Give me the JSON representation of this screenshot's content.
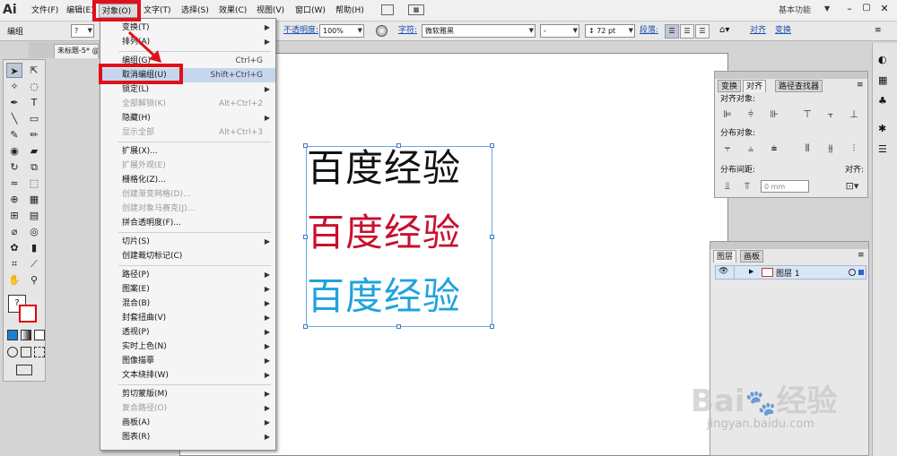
{
  "app": {
    "logo": "Ai"
  },
  "menubar": {
    "items": [
      "文件(F)",
      "编辑(E)",
      "对象(O)",
      "文字(T)",
      "选择(S)",
      "效果(C)",
      "视图(V)",
      "窗口(W)",
      "帮助(H)"
    ],
    "workspace": "基本功能"
  },
  "control_bar": {
    "group_label": "编组",
    "opacity_label": "不透明度:",
    "opacity_value": "100%",
    "char_label": "字符:",
    "font_name": "微软雅黑",
    "font_style": "-",
    "font_size": "72 pt",
    "paragraph_label": "段落:",
    "align_label": "对齐",
    "transform_label": "变换"
  },
  "document": {
    "tab_title": "未标题-5* @"
  },
  "object_menu": {
    "items": [
      {
        "label": "变换(T)",
        "shortcut": "",
        "submenu": true,
        "disabled": false
      },
      {
        "label": "排列(A)",
        "shortcut": "",
        "submenu": true,
        "disabled": false
      },
      {
        "separator": true
      },
      {
        "label": "编组(G)",
        "shortcut": "Ctrl+G",
        "submenu": false,
        "disabled": false
      },
      {
        "label": "取消编组(U)",
        "shortcut": "Shift+Ctrl+G",
        "submenu": false,
        "disabled": false,
        "highlighted": true
      },
      {
        "label": "锁定(L)",
        "shortcut": "",
        "submenu": true,
        "disabled": false
      },
      {
        "label": "全部解锁(K)",
        "shortcut": "Alt+Ctrl+2",
        "submenu": false,
        "disabled": true
      },
      {
        "label": "隐藏(H)",
        "shortcut": "",
        "submenu": true,
        "disabled": false
      },
      {
        "label": "显示全部",
        "shortcut": "Alt+Ctrl+3",
        "submenu": false,
        "disabled": true
      },
      {
        "separator": true
      },
      {
        "label": "扩展(X)...",
        "shortcut": "",
        "submenu": false,
        "disabled": false
      },
      {
        "label": "扩展外观(E)",
        "shortcut": "",
        "submenu": false,
        "disabled": true
      },
      {
        "label": "栅格化(Z)...",
        "shortcut": "",
        "submenu": false,
        "disabled": false
      },
      {
        "label": "创建渐变网格(D)...",
        "shortcut": "",
        "submenu": false,
        "disabled": true
      },
      {
        "label": "创建对象马赛克(J)...",
        "shortcut": "",
        "submenu": false,
        "disabled": true
      },
      {
        "label": "拼合透明度(F)...",
        "shortcut": "",
        "submenu": false,
        "disabled": false
      },
      {
        "separator": true
      },
      {
        "label": "切片(S)",
        "shortcut": "",
        "submenu": true,
        "disabled": false
      },
      {
        "label": "创建裁切标记(C)",
        "shortcut": "",
        "submenu": false,
        "disabled": false
      },
      {
        "separator": true
      },
      {
        "label": "路径(P)",
        "shortcut": "",
        "submenu": true,
        "disabled": false
      },
      {
        "label": "图案(E)",
        "shortcut": "",
        "submenu": true,
        "disabled": false
      },
      {
        "label": "混合(B)",
        "shortcut": "",
        "submenu": true,
        "disabled": false
      },
      {
        "label": "封套扭曲(V)",
        "shortcut": "",
        "submenu": true,
        "disabled": false
      },
      {
        "label": "透视(P)",
        "shortcut": "",
        "submenu": true,
        "disabled": false
      },
      {
        "label": "实时上色(N)",
        "shortcut": "",
        "submenu": true,
        "disabled": false
      },
      {
        "label": "图像描摹",
        "shortcut": "",
        "submenu": true,
        "disabled": false
      },
      {
        "label": "文本绕排(W)",
        "shortcut": "",
        "submenu": true,
        "disabled": false
      },
      {
        "separator": true
      },
      {
        "label": "剪切蒙版(M)",
        "shortcut": "",
        "submenu": true,
        "disabled": false
      },
      {
        "label": "复合路径(O)",
        "shortcut": "",
        "submenu": true,
        "disabled": true
      },
      {
        "label": "画板(A)",
        "shortcut": "",
        "submenu": true,
        "disabled": false
      },
      {
        "label": "图表(R)",
        "shortcut": "",
        "submenu": true,
        "disabled": false
      }
    ]
  },
  "artwork": {
    "lines": [
      {
        "text": "百度经验",
        "color": "#111111"
      },
      {
        "text": "百度经验",
        "color": "#c8102e"
      },
      {
        "text": "百度经验",
        "color": "#1fa3dd"
      }
    ]
  },
  "align_panel": {
    "tabs": [
      "变换",
      "对齐",
      "路径查找器"
    ],
    "align_objects": "对齐对象:",
    "distribute_objects": "分布对象:",
    "distribute_spacing": "分布间距:",
    "align_to": "对齐:",
    "spacing_value": "0 mm"
  },
  "layers_panel": {
    "tabs": [
      "图层",
      "画板"
    ],
    "layer_name": "图层 1"
  },
  "watermark": {
    "brand": "Bai",
    "brand2": "经验",
    "url": "jingyan.baidu.com"
  },
  "colors": {
    "highlight_red": "#e0101a",
    "menu_highlight": "#c5d6ee"
  }
}
